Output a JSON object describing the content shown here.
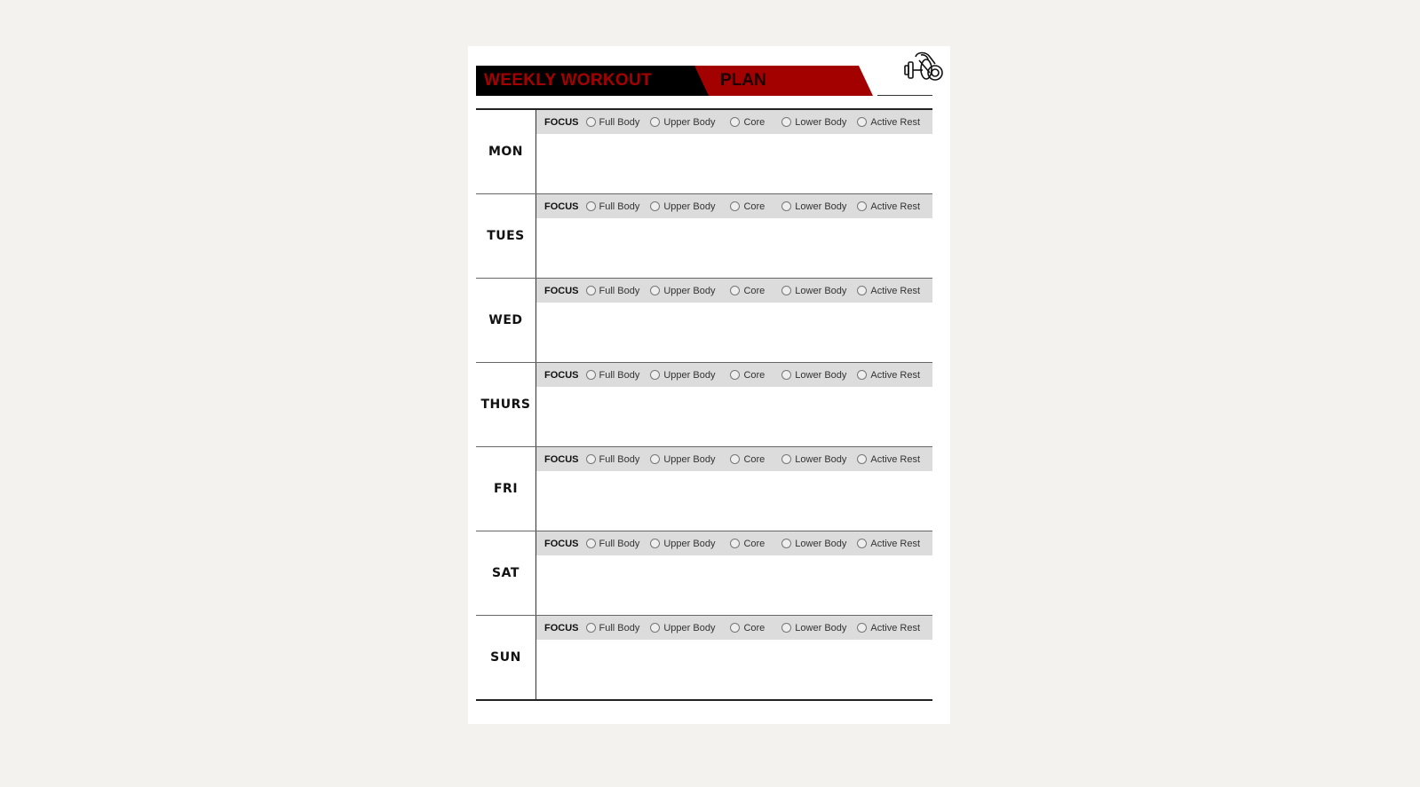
{
  "header": {
    "title_part1": "WEEKLY WORKOUT",
    "title_part2": "PLAN",
    "logo_icon": "dumbbell-icon",
    "colors": {
      "black_band": "#000000",
      "red_band": "#a30000",
      "title_red": "#a30000"
    }
  },
  "focus_label": "FOCUS",
  "focus_options": [
    "Full Body",
    "Upper Body",
    "Core",
    "Lower Body",
    "Active Rest"
  ],
  "days": [
    {
      "label": "MON"
    },
    {
      "label": "TUES"
    },
    {
      "label": "WED"
    },
    {
      "label": "THURS"
    },
    {
      "label": "FRI"
    },
    {
      "label": "SAT"
    },
    {
      "label": "SUN"
    }
  ]
}
